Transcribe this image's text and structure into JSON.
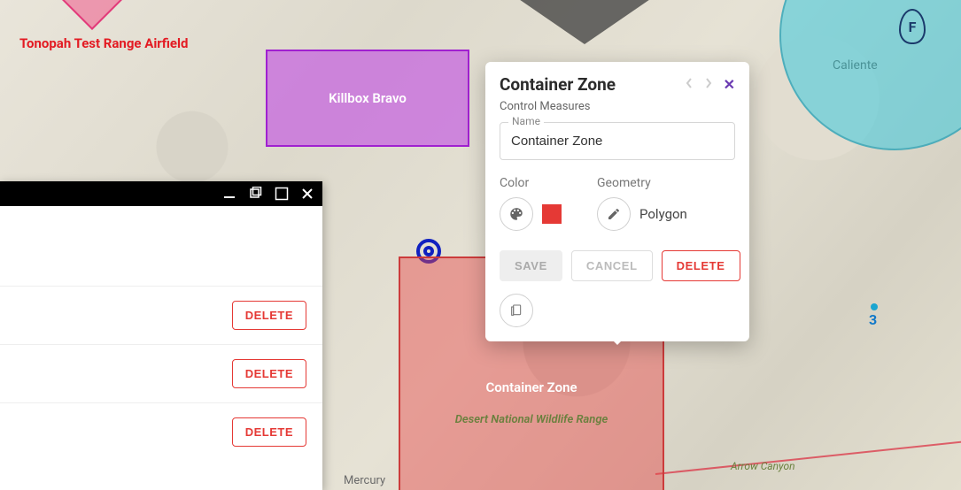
{
  "map": {
    "airfield_label": "Tonopah Test Range Airfield",
    "killbox_label": "Killbox Bravo",
    "container_label": "Container Zone",
    "wildlife_label": "Desert National Wildlife Range",
    "caliente_label": "Caliente",
    "mercury_label": "Mercury",
    "arrow_canyon_label": "Arrow Canyon",
    "cyan_marker_letter": "F",
    "blue_number": "3"
  },
  "overlays": {
    "killbox": {
      "fill": "rgba(190,60,230,0.55)",
      "stroke": "#a020d0"
    },
    "container": {
      "fill": "rgba(230,70,70,0.45)",
      "stroke": "#cc3b3b"
    }
  },
  "side_panel": {
    "rows": [
      {
        "delete_label": "DELETE"
      },
      {
        "delete_label": "DELETE"
      },
      {
        "delete_label": "DELETE"
      }
    ]
  },
  "popup": {
    "title": "Container Zone",
    "subtitle": "Control Measures",
    "name_label": "Name",
    "name_value": "Container Zone",
    "color_label": "Color",
    "color_value": "#e53935",
    "geometry_label": "Geometry",
    "geometry_value": "Polygon",
    "save_label": "SAVE",
    "cancel_label": "CANCEL",
    "delete_label": "DELETE"
  }
}
